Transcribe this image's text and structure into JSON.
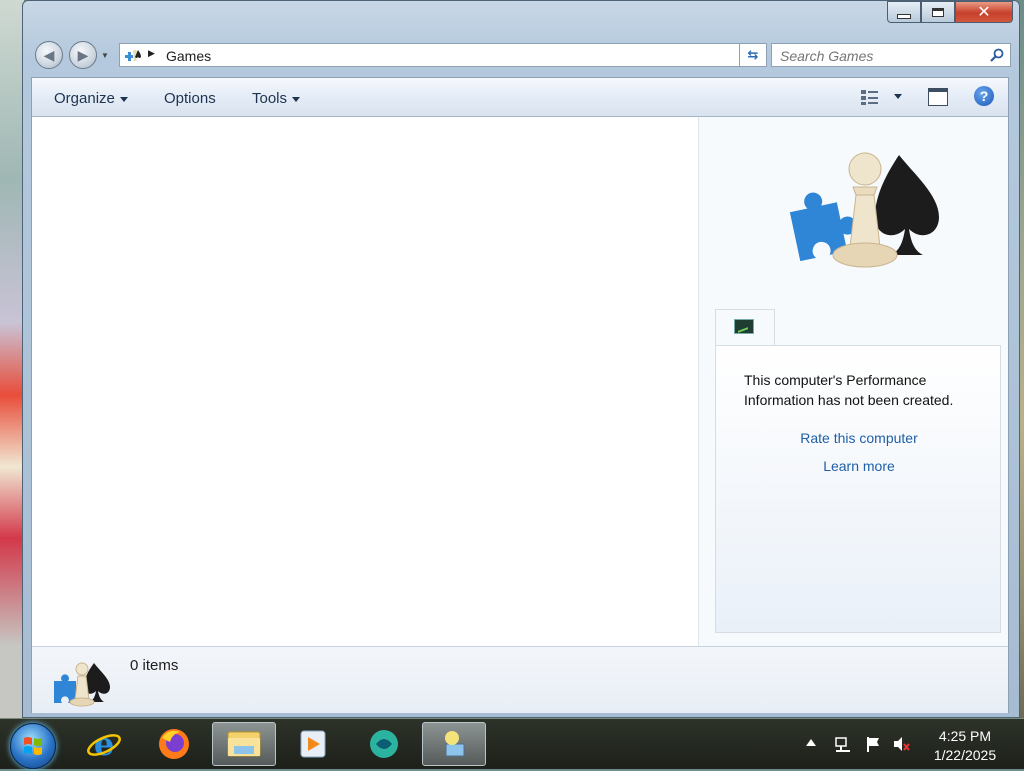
{
  "window": {
    "address": {
      "location": "Games"
    },
    "search": {
      "placeholder": "Search Games"
    }
  },
  "toolbar": {
    "organize_label": "Organize",
    "options_label": "Options",
    "tools_label": "Tools"
  },
  "details_pane": {
    "performance_message": "This computer's Performance Information has not been created.",
    "rate_link": "Rate this computer",
    "learn_link": "Learn more"
  },
  "status_bar": {
    "items_count": "0 items"
  },
  "taskbar": {
    "clock_time": "4:25 PM",
    "clock_date": "1/22/2025",
    "pinned_icons": [
      "internet-explorer-icon",
      "firefox-icon",
      "windows-explorer-icon",
      "media-player-icon",
      "messenger-icon",
      "network-app-icon"
    ],
    "active_item": "windows-explorer-icon"
  },
  "colors": {
    "link": "#1f5fa8",
    "toolbar_text": "#1e3350",
    "close_button": "#c7402b"
  }
}
